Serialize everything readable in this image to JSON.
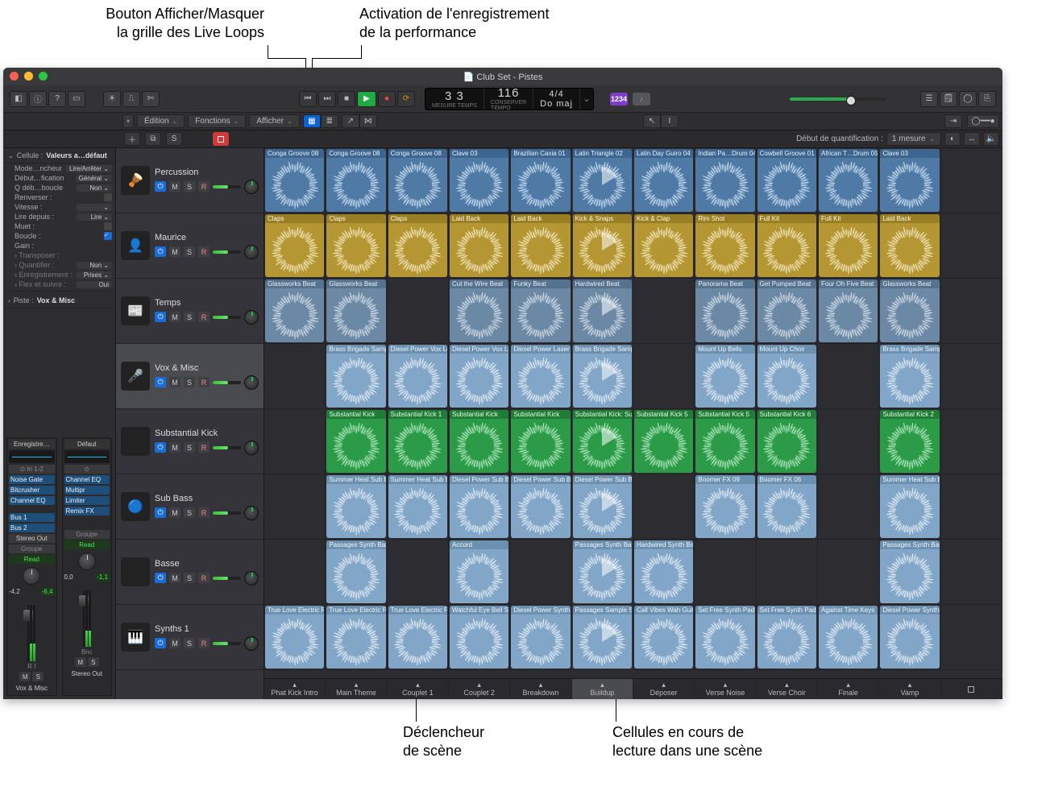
{
  "callouts": {
    "toggle_grid": "Bouton Afficher/Masquer\nla grille des Live Loops",
    "rec_perf": "Activation de l'enregistrement\nde la performance",
    "scene_trigger": "Déclencheur\nde scène",
    "playing_cells": "Cellules en cours de\nlecture dans une scène"
  },
  "window": {
    "title": "Club Set - Pistes"
  },
  "toolbar": {
    "lcd": {
      "beat": "3 3",
      "beat_labels": "MESURE   TEMPS",
      "tempo": "116",
      "tempo_label": "CONSERVER\nTEMPO",
      "sig": "4/4",
      "key": "Do maj"
    },
    "badge_num": "1234"
  },
  "subtoolbar": {
    "edit": "Édition",
    "functions": "Fonctions",
    "view": "Afficher"
  },
  "tertiary": {
    "button_s": "S",
    "quant_label": "Début de quantification :",
    "quant_value": "1 mesure"
  },
  "inspector": {
    "title_label": "Cellule :",
    "title_value": "Valeurs a…défaut",
    "rows": [
      {
        "k": "Mode…ncheur",
        "v": "Lire/Arrêter",
        "chev": true
      },
      {
        "k": "Début…fication",
        "v": "Général",
        "chev": true
      },
      {
        "k": "Q déb…boucle",
        "v": "Non",
        "chev": true
      },
      {
        "k": "Renverser :",
        "v": "",
        "chk": false
      },
      {
        "k": "Vitesse :",
        "v": "",
        "chev": true
      },
      {
        "k": "Lire depuis :",
        "v": "Lire",
        "chev": true
      },
      {
        "k": "Muet :",
        "v": "",
        "chk": false
      },
      {
        "k": "Boucle :",
        "v": "",
        "chk": true
      },
      {
        "k": "Gain :",
        "v": ""
      },
      {
        "k": "Transposer :",
        "v": "",
        "arrow": true
      },
      {
        "k": "Quantifier :",
        "v": "Non",
        "arrow": true,
        "chev": true
      },
      {
        "k": "Enregistrement :",
        "v": "Prises",
        "arrow": true,
        "chev": true
      },
      {
        "k": "Flex et suivre :",
        "v": "Oui",
        "arrow": true
      }
    ],
    "piste_label": "Piste :",
    "piste_value": "Vox & Misc",
    "strips": {
      "left": {
        "head": "Enregistre…",
        "io": "In 1-2",
        "fx": [
          "Noise Gate",
          "Bitcrusher",
          "Channel EQ"
        ],
        "bus": [
          "Bus 1",
          "Bus 2"
        ],
        "out": "Stereo Out",
        "grp": "Groupe",
        "read": "Read",
        "db1": "-4,2",
        "db2": "-6,4",
        "ri": "R I",
        "btns": [
          "M",
          "S"
        ],
        "name": "Vox & Misc"
      },
      "right": {
        "head": "Défaut",
        "io": "",
        "fx": [
          "Channel EQ",
          "Multipr",
          "Limiter",
          "Remix FX"
        ],
        "bus": [],
        "out": "",
        "grp": "Groupe",
        "read": "Read",
        "db1": "0,0",
        "db2": "-1,1",
        "ri": "Bnc",
        "btns": [
          "M",
          "S"
        ],
        "name": "Stereo Out"
      }
    }
  },
  "tracks": [
    {
      "name": "Percussion",
      "icon": "🪘"
    },
    {
      "name": "Maurice",
      "icon": "👤"
    },
    {
      "name": "Temps",
      "icon": "📰"
    },
    {
      "name": "Vox & Misc",
      "icon": "🎤",
      "selected": true
    },
    {
      "name": "Substantial Kick",
      "icon": ""
    },
    {
      "name": "Sub Bass",
      "icon": "🔵"
    },
    {
      "name": "Basse",
      "icon": ""
    },
    {
      "name": "Synths 1",
      "icon": "🎹"
    }
  ],
  "scenes": [
    "Phat Kick Intro",
    "Main Theme",
    "Couplet 1",
    "Couplet 2",
    "Breakdown",
    "Buildup",
    "Déposer",
    "Verse Noise",
    "Verse Choir",
    "Finale",
    "Vamp",
    ""
  ],
  "playing_scene_index": 5,
  "grid_rows": [
    {
      "color": "blue",
      "cells": [
        "Conga Groove 08",
        "Conga Groove 08",
        "Conga Groove 08",
        "Clave 03",
        "Brazilian Caxia 01",
        "Latin Triangle 02",
        "Latin Day Guiro 04",
        "Indian Pa…Drum 04",
        "Cowbell Groove 01",
        "African T…Drum 05",
        "Clave 03",
        ""
      ]
    },
    {
      "color": "yellow",
      "cells": [
        "Claps",
        "Claps",
        "Claps",
        "Laid Back",
        "Laid Back",
        "Kick & Snaps",
        "Kick & Clap",
        "Rim Shot",
        "Full Kit",
        "Full Kit",
        "Laid Back",
        ""
      ]
    },
    {
      "color": "steel",
      "cells": [
        "Glassworks Beat",
        "Glassworks Beat",
        "",
        "Cut the Wire Beat",
        "Funky Beat",
        "Hardwired Beat",
        "",
        "Panorama Beat",
        "Get Pumped Beat",
        "Four Oh Five Beat",
        "Glassworks Beat",
        ""
      ]
    },
    {
      "color": "sky",
      "cells": [
        "",
        "Brass Brigade Sample",
        "Diesel Power Vox Lea",
        "Diesel Power Vox Lea",
        "Diesel Power Laser F",
        "Brass Brigade Sample",
        "",
        "Mount Up Bells",
        "Mount Up Choir",
        "",
        "Brass Brigade Sample",
        ""
      ]
    },
    {
      "color": "green",
      "cells": [
        "",
        "Substantial Kick",
        "Substantial Kick 1",
        "Substantial Kick",
        "Substantial Kick",
        "Substantial Kick: Sub",
        "Substantial Kick 5",
        "Substantial Kick 5",
        "Substantial Kick 6",
        "",
        "Substantial Kick 2",
        ""
      ]
    },
    {
      "color": "sky",
      "cells": [
        "",
        "Summer Heat Sub Ba",
        "Summer Heat Sub Ba",
        "Diesel Power Sub Ba",
        "Diesel Power Sub Ba",
        "Diesel Power Sub Ba",
        "",
        "Boomer FX 09",
        "Boomer FX 06",
        "",
        "Summer Heat Sub Ba",
        ""
      ]
    },
    {
      "color": "sky",
      "cells": [
        "",
        "Passages Synth Bass",
        "",
        "Accord",
        "",
        "Passages Synth Bass",
        "Hardwired Synth Bas",
        "",
        "",
        "",
        "Passages Synth Bass",
        ""
      ]
    },
    {
      "color": "sky",
      "cells": [
        "True Love Electric Pia",
        "True Love Electric Pia",
        "True Love Electric Pia",
        "Watchful Eye Bell Syn",
        "Diesel Power Synth L",
        "Passages Sample Sta",
        "Call Vibes Wah Guita",
        "Set Free Synth Pad",
        "Set Free Synth Pad",
        "Against Time Keys",
        "Diesel Power Synth L",
        ""
      ]
    }
  ]
}
